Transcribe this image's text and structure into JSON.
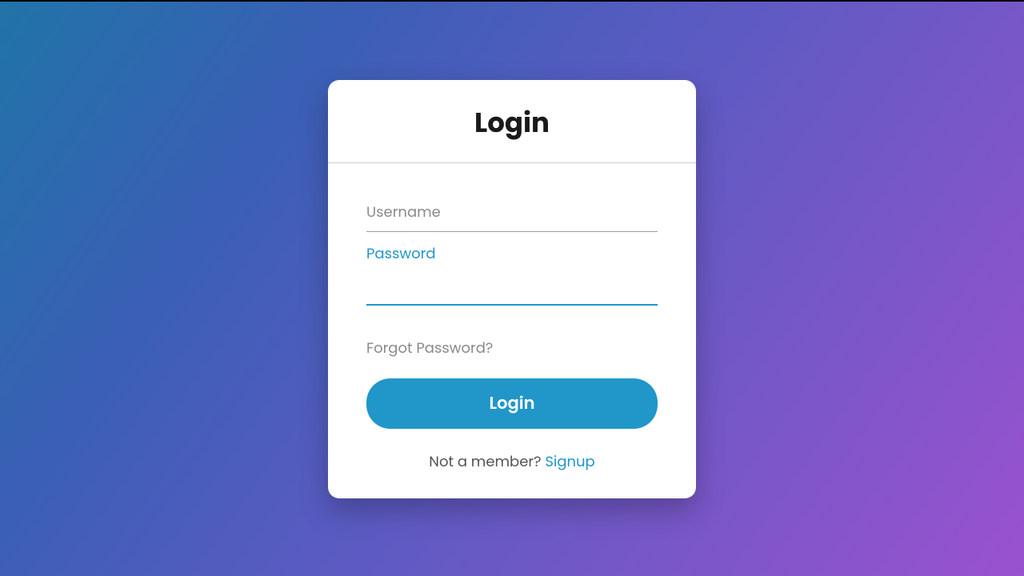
{
  "title": "Login",
  "fields": {
    "username": {
      "placeholder": "Username",
      "value": ""
    },
    "password": {
      "label": "Password",
      "value": ""
    }
  },
  "links": {
    "forgot": "Forgot Password?",
    "signup_prompt": "Not a member? ",
    "signup": "Signup"
  },
  "buttons": {
    "login": "Login"
  },
  "colors": {
    "accent": "#2196c9",
    "gradient_start": "#2074a8",
    "gradient_end": "#9a52cf"
  }
}
